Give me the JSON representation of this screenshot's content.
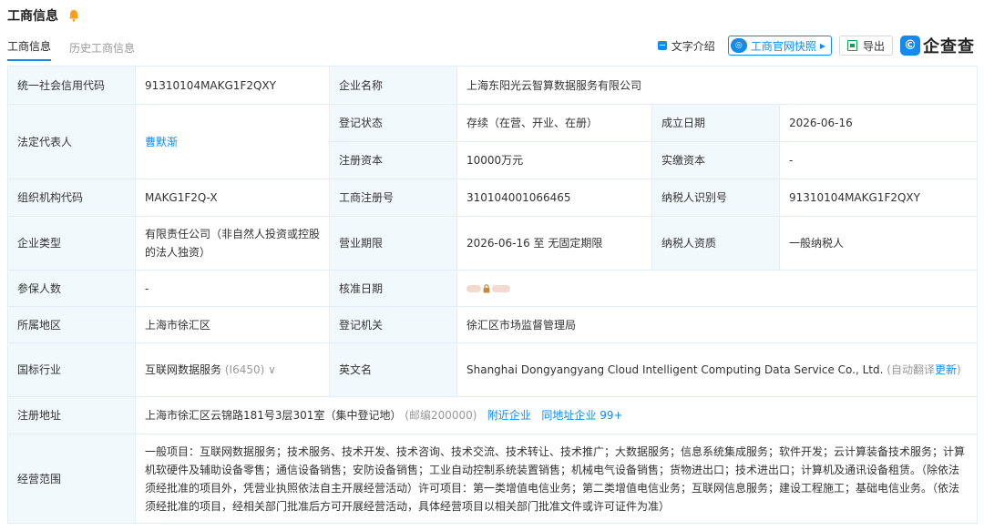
{
  "header": {
    "title": "工商信息"
  },
  "tabs": [
    {
      "label": "工商信息"
    },
    {
      "label": "历史工商信息"
    }
  ],
  "toolbar": {
    "intro_label": "文字介绍",
    "snapshot_label": "工商官网快照",
    "export_label": "导出",
    "logo_text": "企查查"
  },
  "table": {
    "credit_code_label": "统一社会信用代码",
    "credit_code": "91310104MAKG1F2QXY",
    "company_name_label": "企业名称",
    "company_name": "上海东阳光云智算数据服务有限公司",
    "legal_rep_label": "法定代表人",
    "legal_rep": "曹默渐",
    "status_label": "登记状态",
    "status": "存续（在营、开业、在册）",
    "founded_label": "成立日期",
    "founded": "2026-06-16",
    "reg_capital_label": "注册资本",
    "reg_capital": "10000万元",
    "paid_capital_label": "实缴资本",
    "paid_capital": "-",
    "org_code_label": "组织机构代码",
    "org_code": "MAKG1F2Q-X",
    "biz_reg_no_label": "工商注册号",
    "biz_reg_no": "310104001066465",
    "taxpayer_id_label": "纳税人识别号",
    "taxpayer_id": "91310104MAKG1F2QXY",
    "company_type_label": "企业类型",
    "company_type": "有限责任公司（非自然人投资或控股的法人独资）",
    "biz_term_label": "营业期限",
    "biz_term": "2026-06-16 至 无固定期限",
    "taxpayer_qual_label": "纳税人资质",
    "taxpayer_qual": "一般纳税人",
    "insured_label": "参保人数",
    "insured": "-",
    "approval_date_label": "核准日期",
    "approval_date_suffix": "VIP",
    "region_label": "所属地区",
    "region": "上海市徐汇区",
    "authority_label": "登记机关",
    "authority": "徐汇区市场监督管理局",
    "industry_label": "国标行业",
    "industry": "互联网数据服务",
    "industry_code": "(I6450)",
    "english_name_label": "英文名",
    "english_name": "Shanghai Dongyangyang Cloud Intelligent Computing Data Service Co., Ltd.",
    "auto_translate": "(自动翻译",
    "update_link": "更新",
    "close_paren": ")",
    "address_label": "注册地址",
    "address": "上海市徐汇区云锦路181号3层301室（集中登记地）",
    "postcode": "(邮编200000)",
    "nearby_link": "附近企业",
    "same_address_link": "同地址企业 99+",
    "scope_label": "经营范围",
    "scope": "一般项目：互联网数据服务；技术服务、技术开发、技术咨询、技术交流、技术转让、技术推广；大数据服务；信息系统集成服务；软件开发；云计算装备技术服务；计算机软硬件及辅助设备零售；通信设备销售；安防设备销售；工业自动控制系统装置销售；机械电气设备销售；货物进出口；技术进出口；计算机及通讯设备租赁。（除依法须经批准的项目外，凭营业执照依法自主开展经营活动）许可项目：第一类增值电信业务；第二类增值电信业务；互联网信息服务；建设工程施工；基础电信业务。（依法须经批准的项目，经相关部门批准后方可开展经营活动，具体经营项目以相关部门批准文件或许可证件为准）"
  },
  "colors": {
    "accent": "#128bed",
    "label_bg": "#f2f9fc",
    "border": "#e4eef6"
  }
}
